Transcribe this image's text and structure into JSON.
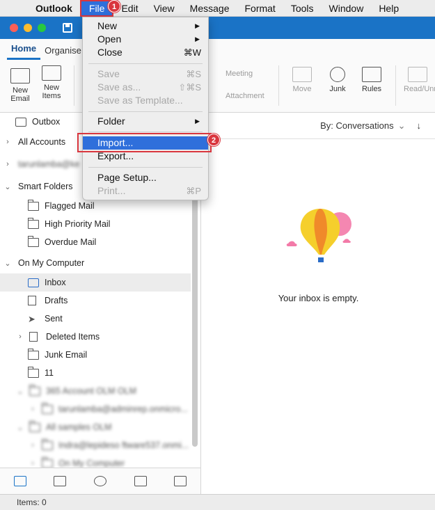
{
  "menubar": {
    "app": "Outlook",
    "items": [
      "File",
      "Edit",
      "View",
      "Message",
      "Format",
      "Tools",
      "Window",
      "Help"
    ]
  },
  "ribbon": {
    "tabs": [
      "Home",
      "Organise"
    ],
    "buttons": {
      "new_email": "New\nEmail",
      "new_items": "New\nItems",
      "meeting": "Meeting",
      "attachment": "Attachment",
      "move": "Move",
      "junk": "Junk",
      "rules": "Rules",
      "read_unread": "Read/Unread"
    }
  },
  "file_menu": {
    "new": "New",
    "open": "Open",
    "close": "Close",
    "close_shortcut": "⌘W",
    "save": "Save",
    "save_shortcut": "⌘S",
    "save_as": "Save as...",
    "save_as_shortcut": "⇧⌘S",
    "save_template": "Save as Template...",
    "folder": "Folder",
    "import": "Import...",
    "export": "Export...",
    "page_setup": "Page Setup...",
    "print": "Print...",
    "print_shortcut": "⌘P"
  },
  "annotations": {
    "badge1": "1",
    "badge2": "2"
  },
  "sidebar": {
    "outbox": "Outbox",
    "all_accounts": "All Accounts",
    "account_email": "tarunlamba@ke",
    "smart_folders": "Smart Folders",
    "flagged": "Flagged Mail",
    "high_priority": "High Priority Mail",
    "overdue": "Overdue Mail",
    "on_my_computer": "On My Computer",
    "inbox": "Inbox",
    "drafts": "Drafts",
    "sent": "Sent",
    "deleted": "Deleted Items",
    "junk": "Junk Email",
    "folder_11": "11",
    "blur1": "365 Account OLM OLM",
    "blur2": "tarunlamba@adminrep.onmicro...",
    "blur3": "All samples OLM",
    "blur4": "Indra@lepideso ftware537.onmi...",
    "blur5": "On My Computer"
  },
  "content": {
    "sort_label": "By: Conversations",
    "empty_message": "Your inbox is empty."
  },
  "status": {
    "items": "Items: 0"
  }
}
